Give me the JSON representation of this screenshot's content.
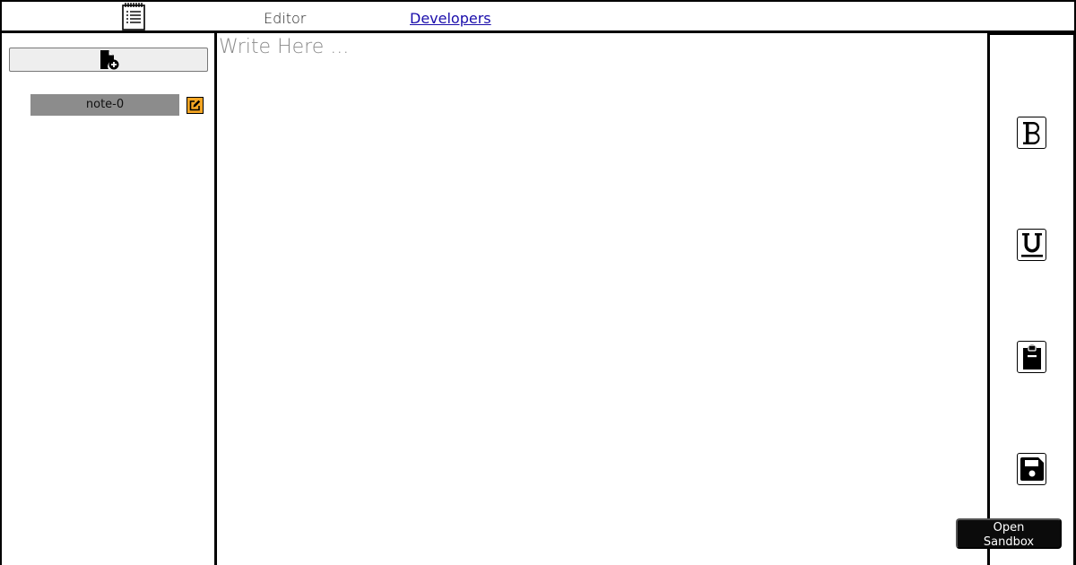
{
  "header": {
    "logo_icon": "notepad-icon",
    "nav_editor": "Editor",
    "nav_developers": "Developers"
  },
  "sidebar": {
    "new_note_icon": "file-plus-icon",
    "notes": [
      {
        "title": "note-0",
        "edit_icon": "edit-icon"
      }
    ],
    "accent_color": "#f5a623"
  },
  "editor": {
    "placeholder": "Write Here ...",
    "value": ""
  },
  "toolbar": {
    "buttons": [
      {
        "icon": "bold-icon"
      },
      {
        "icon": "underline-icon"
      },
      {
        "icon": "clipboard-icon"
      },
      {
        "icon": "save-icon"
      }
    ]
  },
  "sandbox": {
    "label": "Open Sandbox"
  }
}
